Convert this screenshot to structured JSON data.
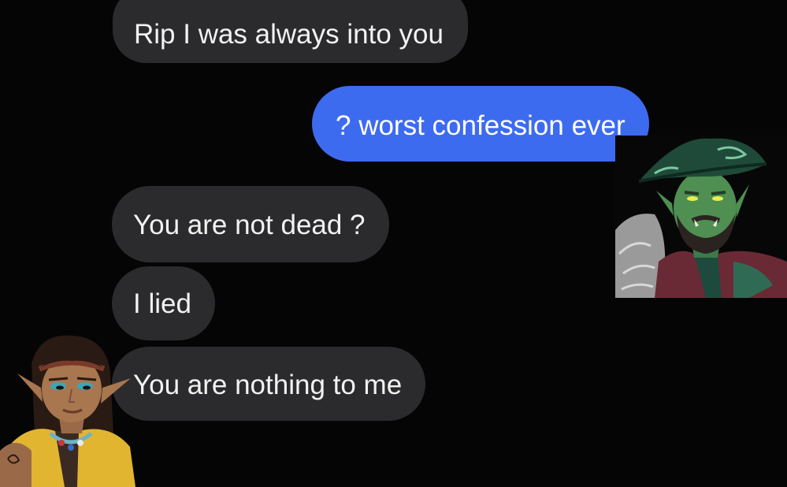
{
  "messages": [
    {
      "text": "Rip I was always into you",
      "direction": "received"
    },
    {
      "text": "? worst confession ever",
      "direction": "sent"
    },
    {
      "text": "You are not dead ?",
      "direction": "received"
    },
    {
      "text": "I lied",
      "direction": "received"
    },
    {
      "text": "You are nothing to me",
      "direction": "received"
    }
  ],
  "colors": {
    "background": "#050505",
    "received_bubble": "#2b2b2d",
    "sent_bubble": "#3d6bf0",
    "text": "#f2f2f2"
  }
}
